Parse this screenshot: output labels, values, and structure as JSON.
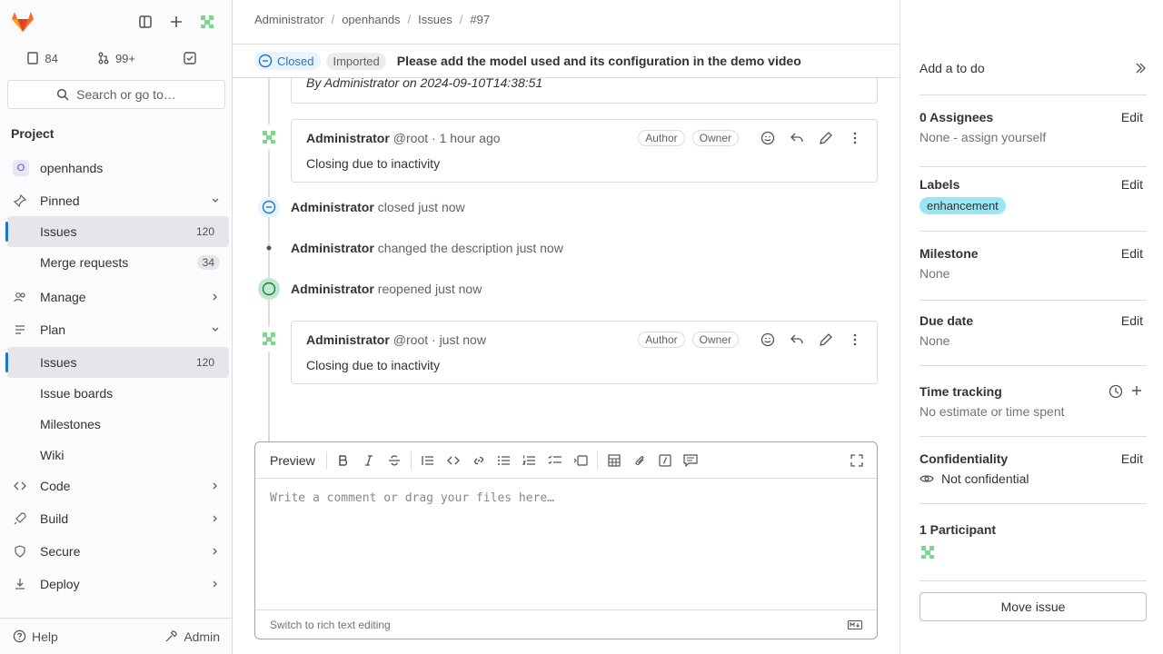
{
  "sidebar": {
    "counts": {
      "issues": "84",
      "merge_requests": "99+"
    },
    "search_label": "Search or go to…",
    "section_title": "Project",
    "items": [
      {
        "name": "project-openhands",
        "label": "openhands",
        "count": ""
      },
      {
        "name": "pinned",
        "label": "Pinned",
        "count": ""
      },
      {
        "name": "pinned-issues",
        "label": "Issues",
        "count": "120"
      },
      {
        "name": "pinned-merge-requests",
        "label": "Merge requests",
        "count": "34"
      },
      {
        "name": "manage",
        "label": "Manage",
        "count": ""
      },
      {
        "name": "plan",
        "label": "Plan",
        "count": ""
      },
      {
        "name": "plan-issues",
        "label": "Issues",
        "count": "120"
      },
      {
        "name": "issue-boards",
        "label": "Issue boards",
        "count": ""
      },
      {
        "name": "milestones",
        "label": "Milestones",
        "count": ""
      },
      {
        "name": "wiki",
        "label": "Wiki",
        "count": ""
      },
      {
        "name": "code",
        "label": "Code",
        "count": ""
      },
      {
        "name": "build",
        "label": "Build",
        "count": ""
      },
      {
        "name": "secure",
        "label": "Secure",
        "count": ""
      },
      {
        "name": "deploy",
        "label": "Deploy",
        "count": ""
      }
    ],
    "help_label": "Help",
    "admin_label": "Admin"
  },
  "breadcrumb": [
    "Administrator",
    "openhands",
    "Issues",
    "#97"
  ],
  "issue": {
    "status": "Closed",
    "imported": "Imported",
    "title": "Please add the model used and its configuration in the demo video"
  },
  "timeline": {
    "partial_meta": "By Administrator on 2024-09-10T14:38:51",
    "notes": [
      {
        "author": "Administrator",
        "meta": "@root · 1 hour ago",
        "role_author": "Author",
        "role_owner": "Owner",
        "body": "Closing due to inactivity"
      },
      {
        "author": "Administrator",
        "meta": "@root · just now",
        "role_author": "Author",
        "role_owner": "Owner",
        "body": "Closing due to inactivity"
      }
    ],
    "system": [
      {
        "who": "Administrator",
        "action": "closed",
        "when": "just now"
      },
      {
        "who": "Administrator",
        "action": "changed the description",
        "when": "just now"
      },
      {
        "who": "Administrator",
        "action": "reopened",
        "when": "just now"
      }
    ]
  },
  "editor": {
    "preview_label": "Preview",
    "placeholder": "Write a comment or drag your files here…",
    "switch_label": "Switch to rich text editing"
  },
  "right": {
    "todo": "Add a to do",
    "assignees_label": "0 Assignees",
    "assignees_value": "None - assign yourself",
    "edit": "Edit",
    "labels_label": "Labels",
    "label_chip": "enhancement",
    "milestone_label": "Milestone",
    "milestone_value": "None",
    "due_label": "Due date",
    "due_value": "None",
    "time_label": "Time tracking",
    "time_value": "No estimate or time spent",
    "conf_label": "Confidentiality",
    "conf_value": "Not confidential",
    "participants_label": "1 Participant",
    "move_issue": "Move issue"
  },
  "colors": {
    "accent": "#1f75cb",
    "label_chip": "#9ae6f1",
    "closed_bg": "#e9f3fc"
  }
}
